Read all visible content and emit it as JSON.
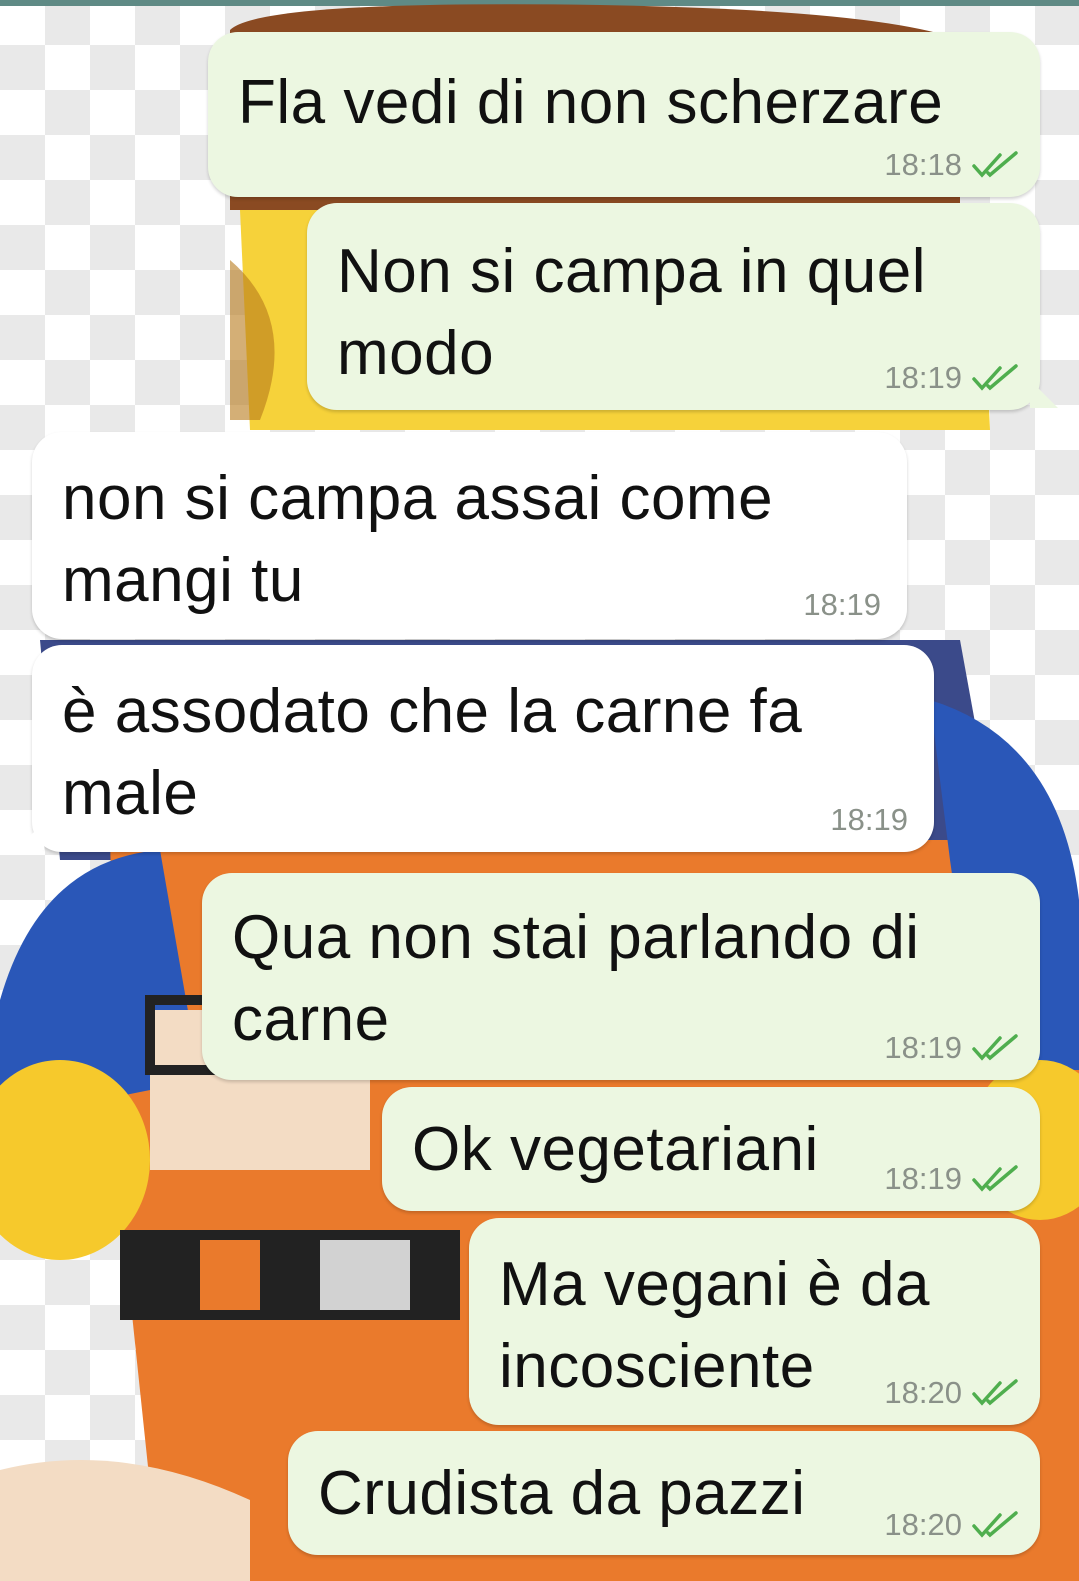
{
  "messages": [
    {
      "text": "Fla vedi di non scherzare",
      "time": "18:18",
      "direction": "outgoing",
      "status": "read-ticks-icon"
    },
    {
      "text": "Non si campa in quel\nmodo",
      "time": "18:19",
      "direction": "outgoing",
      "status": "read-ticks-icon"
    },
    {
      "text": "non si campa assai come\nmangi tu",
      "time": "18:19",
      "direction": "incoming"
    },
    {
      "text": "è assodato che la carne fa\nmale",
      "time": "18:19",
      "direction": "incoming"
    },
    {
      "text": "Qua non stai parlando di\ncarne",
      "time": "18:19",
      "direction": "outgoing",
      "status": "read-ticks-icon"
    },
    {
      "text": "Ok vegetariani",
      "time": "18:19",
      "direction": "outgoing",
      "status": "read-ticks-icon"
    },
    {
      "text": "Ma vegani è da\nincosciente",
      "time": "18:20",
      "direction": "outgoing",
      "status": "read-ticks-icon"
    },
    {
      "text": "Crudista da pazzi",
      "time": "18:20",
      "direction": "outgoing",
      "status": "read-ticks-icon"
    }
  ],
  "colors": {
    "outgoing_bubble": "#ecf7e1",
    "incoming_bubble": "#ffffff",
    "tick_color": "#4fae4e",
    "top_bar": "#5f8a85"
  }
}
